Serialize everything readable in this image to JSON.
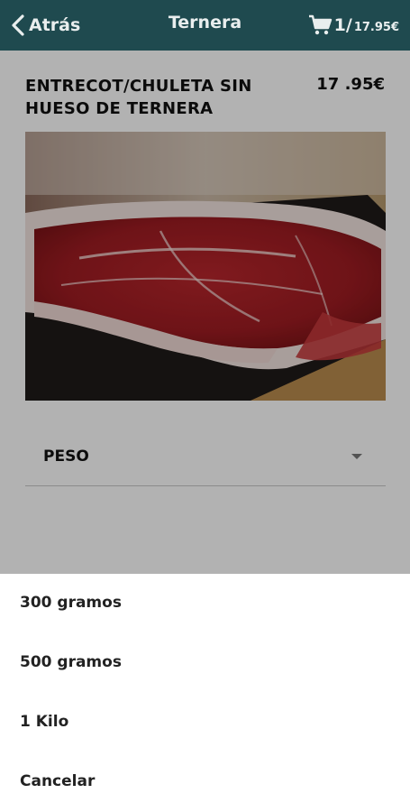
{
  "header": {
    "back_label": "Atrás",
    "title": "Ternera",
    "cart_count": "1/",
    "cart_total": "17.95€"
  },
  "product": {
    "name": "ENTRECOT/CHULETA SIN HUESO DE TERNERA",
    "price": "17 .95€",
    "weight_label": "PESO"
  },
  "action_sheet": {
    "options": [
      {
        "label": "300 gramos"
      },
      {
        "label": "500 gramos"
      },
      {
        "label": "1 Kilo"
      }
    ],
    "cancel_label": "Cancelar"
  },
  "colors": {
    "header_bg": "#1f4a4f",
    "overlay": "rgba(0,0,0,0.30)"
  },
  "icons": [
    "chevron-left-icon",
    "cart-icon",
    "caret-down-icon"
  ]
}
